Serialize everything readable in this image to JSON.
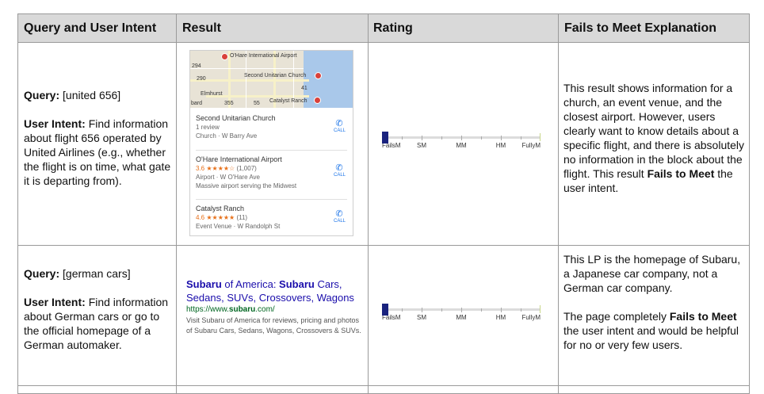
{
  "headers": {
    "query": "Query and User Intent",
    "result": "Result",
    "rating": "Rating",
    "explanation": "Fails to Meet Explanation"
  },
  "labels": {
    "query": "Query:",
    "user_intent": "User Intent:"
  },
  "rows": [
    {
      "query": "[united 656]",
      "intent": "Find information about flight 656 operated by United Airlines (e.g., whether the flight is on time, what gate it is departing from).",
      "explanation_pre": "This result shows information for a church, an event venue, and the closest airport.  However, users clearly want to know details about a specific flight, and there is absolutely no information in the block about the flight.  This result ",
      "explanation_bold": "Fails to Meet",
      "explanation_post": " the user intent."
    },
    {
      "query": "[german cars]",
      "intent": "Find information about German cars or go to the official homepage of a German automaker.",
      "explanation_p1": "This LP is the homepage of Subaru, a Japanese car company, not a German car company.",
      "explanation_p2_pre": "The page completely ",
      "explanation_p2_bold": "Fails to Meet",
      "explanation_p2_post": " the user intent and would be helpful for no or very few users."
    }
  ],
  "rating_scale": [
    "FailsM",
    "SM",
    "MM",
    "HM",
    "FullyM"
  ],
  "ratings": [
    0,
    0
  ],
  "map_card": {
    "map_labels": [
      "O'Hare International Airport",
      "Second Unitarian Church",
      "Elmhurst",
      "Catalyst Ranch",
      "bard"
    ],
    "road_numbers": [
      "294",
      "290",
      "355",
      "55",
      "41"
    ],
    "places": [
      {
        "name": "Second Unitarian Church",
        "line2": "1 review",
        "line3": "Church · W Barry Ave"
      },
      {
        "name": "O'Hare International Airport",
        "rating": "3.6",
        "stars": "★★★★☆",
        "count": "(1,007)",
        "line3": "Airport · W O'Hare Ave",
        "line4": "Massive airport serving the Midwest"
      },
      {
        "name": "Catalyst Ranch",
        "rating": "4.6",
        "stars": "★★★★★",
        "count": "(11)",
        "line3": "Event Venue · W Randolph St"
      }
    ],
    "call_label": "CALL"
  },
  "search_result": {
    "title_b1": "Subaru",
    "title_t1": " of America: ",
    "title_b2": "Subaru",
    "title_t2": " Cars, Sedans, SUVs, Crossovers, Wagons",
    "url_pre": "https://www.",
    "url_bold": "subaru",
    "url_post": ".com/",
    "desc_pre": "Visit ",
    "desc_b1": "Subaru",
    "desc_mid": " of America for reviews, pricing and photos of ",
    "desc_b2": "Subaru",
    "desc_post": " Cars, Sedans, Wagons, Crossovers & SUVs."
  }
}
